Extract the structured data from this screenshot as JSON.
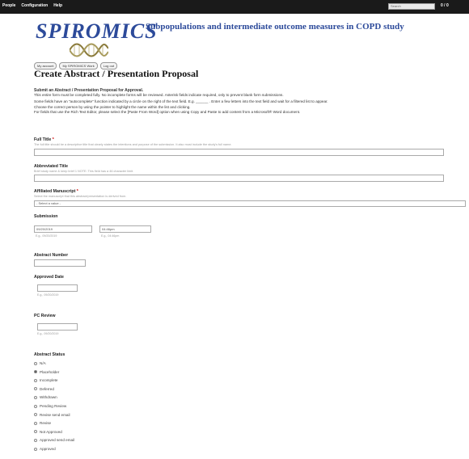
{
  "topbar": {
    "menu": [
      "People",
      "Configuration",
      "Help"
    ],
    "search_value": "Search",
    "count": "0 / 0"
  },
  "brand": {
    "logo_text": "SPIROMICS",
    "tagline": "Subpopulations and intermediate outcome measures in COPD study"
  },
  "subnav": [
    "My account",
    "My SPIROMICS Work",
    "Log out"
  ],
  "page_title": "Create Abstract / Presentation Proposal",
  "intro": {
    "heading": "Submit an Abstract / Presentation Proposal for Approval.",
    "line1": "This entire form must be completed fully. No incomplete forms will be reviewed. Asterisk fields indicate required, only to prevent blank form submissions.",
    "line2": "Some fields have an \"autocomplete\" function indicated by a circle on the right of the text field. E.g. ______ . Enter a few letters into the text field and wait for a filtered list to appear.",
    "line3": "Choose the correct person by using the pointer to highlight the name within the list and clicking.",
    "line4": "For fields that use the Rich Text Editor, please select the [Paste From Word] option when using Copy and Paste to add content from a Microsoft® Word document."
  },
  "form": {
    "full_title": {
      "label": "Full Title",
      "help": "The full title should be a descriptive title that clearly states the intentions and purpose of the submission. It also must include the study's full name."
    },
    "abbreviated_title": {
      "label": "Abbreviated Title",
      "help": "Brief study name & keep brief 1 NOTE: This field has a 46 character limit."
    },
    "affiliated_manuscript": {
      "label": "Affiliated Manuscript",
      "help": "Select the manuscript that this abstract/presentation is derived from.",
      "value": "- Select a value -"
    },
    "submission": {
      "label": "Submission",
      "date_value": "09/20/2019",
      "date_hint": "E.g., 09/20/2019",
      "time_value": "04:46pm",
      "time_hint": "E.g., 04:46pm"
    },
    "abstract_number": {
      "label": "Abstract Number"
    },
    "approved_date": {
      "label": "Approved Date",
      "hint": "E.g., 09/20/2019"
    },
    "pc_review": {
      "label": "PC Review",
      "hint": "E.g., 09/20/2019"
    },
    "abstract_status": {
      "label": "Abstract Status",
      "options": [
        "N/A",
        "Placeholder",
        "Incomplete",
        "Deferred",
        "Withdrawn",
        "Pending Review",
        "Revise send email",
        "Revise",
        "Not Approved",
        "Approved send email",
        "Approved"
      ],
      "selected": "Placeholder"
    }
  },
  "colors": {
    "brand": "#2c4a9a",
    "required": "#cc0000",
    "topbar": "#1a1a1a"
  }
}
